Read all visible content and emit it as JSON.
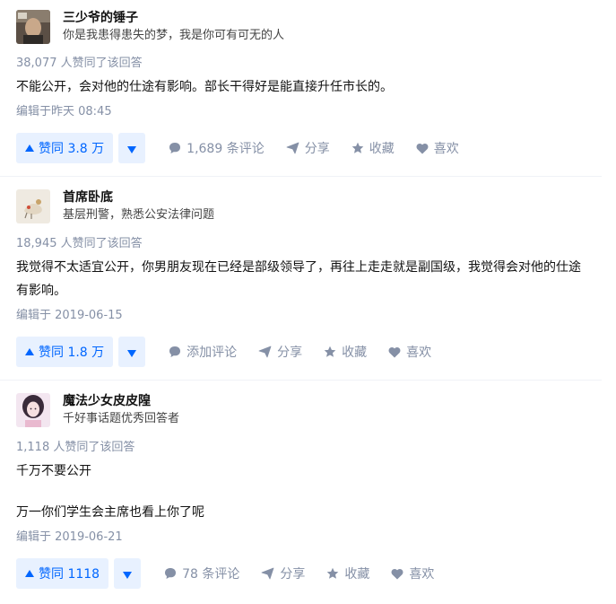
{
  "answers": [
    {
      "author_name": "三少爷的锤子",
      "author_desc": "你是我患得患失的梦，我是你可有可无的人",
      "votes_text": "38,077 人赞同了该回答",
      "paragraphs": [
        "不能公开，会对他的仕途有影响。部长干得好是能直接升任市长的。"
      ],
      "edited": "编辑于昨天 08:45",
      "vote_label": "赞同 3.8 万",
      "comment_label": "1,689 条评论",
      "share_label": "分享",
      "favorite_label": "收藏",
      "like_label": "喜欢"
    },
    {
      "author_name": "首席卧底",
      "author_desc": "基层刑警，熟悉公安法律问题",
      "votes_text": "18,945 人赞同了该回答",
      "paragraphs": [
        "我觉得不太适宜公开，你男朋友现在已经是部级领导了，再往上走走就是副国级，我觉得会对他的仕途有影响。"
      ],
      "edited": "编辑于 2019-06-15",
      "vote_label": "赞同 1.8 万",
      "comment_label": "添加评论",
      "share_label": "分享",
      "favorite_label": "收藏",
      "like_label": "喜欢"
    },
    {
      "author_name": "魔法少女皮皮隍",
      "author_desc": "千好事话题优秀回答者",
      "votes_text": "1,118 人赞同了该回答",
      "paragraphs": [
        "千万不要公开",
        "万一你们学生会主席也看上你了呢"
      ],
      "edited": "编辑于 2019-06-21",
      "vote_label": "赞同 1118",
      "comment_label": "78 条评论",
      "share_label": "分享",
      "favorite_label": "收藏",
      "like_label": "喜欢"
    }
  ],
  "icons": {
    "vote_up": "triangle-up-icon",
    "vote_down": "triangle-down-icon",
    "comment": "comment-bubble-icon",
    "share": "paper-plane-icon",
    "favorite": "star-icon",
    "like": "heart-icon"
  },
  "colors": {
    "accent": "#0066ff",
    "accent_bg": "#e8f1ff",
    "muted": "#8590a6",
    "text": "#121212"
  }
}
